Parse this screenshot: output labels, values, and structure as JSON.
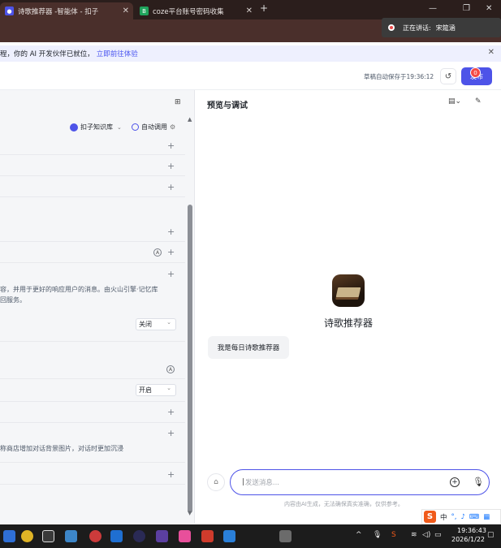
{
  "browser": {
    "tabs": [
      {
        "title": "诗歌推荐器 -智能体 - 扣子",
        "active": true
      },
      {
        "title": "coze平台账号密码收集",
        "active": false
      }
    ],
    "new_tab": "+",
    "speaking_label": "正在讲话:",
    "speaking_name": "宋筵涵"
  },
  "banner": {
    "text": "程，你的 AI 开发伙伴已就位，",
    "link": "立即前往体验"
  },
  "header": {
    "autosave": "草稿自动保存于19:36:12",
    "publish_label": "发布",
    "publish_badge": "0"
  },
  "left_panel": {
    "knowledge_label": "扣子知识库",
    "auto_call_label": "自动调用",
    "memory_desc_1": "容，并用于更好的响应用户的消息。由火山引擎·记忆库",
    "memory_desc_2": "回服务。",
    "select_1": "关闭",
    "select_2": "开启",
    "bg_desc": "称商店增加对话背景图片，对话时更加沉浸",
    "circle_a": "A"
  },
  "preview": {
    "title": "预览与调试",
    "bot_name": "诗歌推荐器",
    "bot_greeting": "我是每日诗歌推荐器",
    "input_placeholder": "发送消息...",
    "disclaimer": "内容由AI生成，无法确保真实准确，仅供参考。"
  },
  "ime": {
    "logo": "S",
    "lang": "中"
  },
  "taskbar": {
    "time": "19:36:43",
    "date": "2026/1/22"
  },
  "colors": {
    "accent": "#4d53e8",
    "banner_bg": "#eef0fe",
    "badge": "#f54a45"
  }
}
